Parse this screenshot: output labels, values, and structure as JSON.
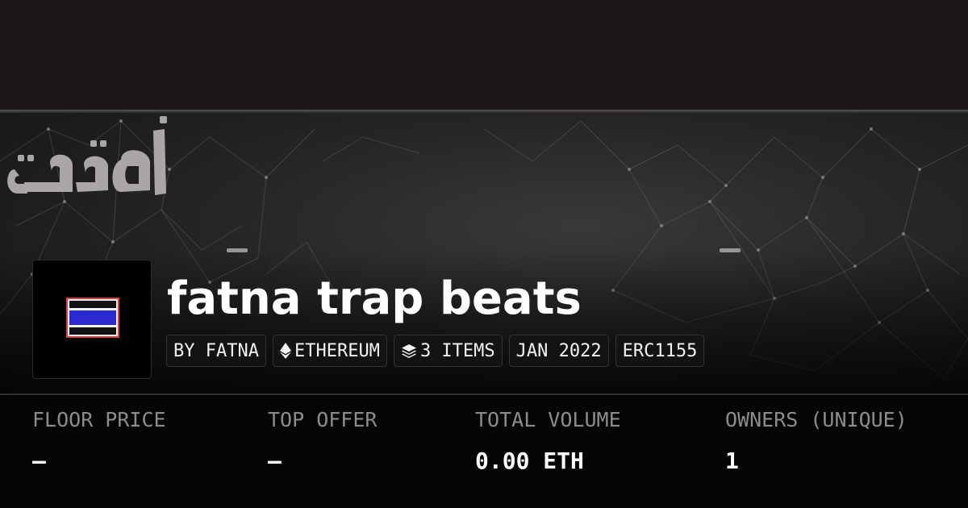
{
  "collection": {
    "title": "fatna trap beats",
    "tags": {
      "creator": "BY FATNA",
      "chain": "ETHEREUM",
      "chain_icon": "ethereum-icon",
      "items": "3 ITEMS",
      "items_icon": "layers-icon",
      "date": "JAN 2022",
      "standard": "ERC1155"
    }
  },
  "stats": {
    "floor_price": {
      "label": "FLOOR PRICE",
      "value": "—"
    },
    "top_offer": {
      "label": "TOP OFFER",
      "value": "—"
    },
    "total_volume": {
      "label": "TOTAL VOLUME",
      "value": "0.00 ETH"
    },
    "owners": {
      "label": "OWNERS (UNIQUE)",
      "value": "1"
    }
  },
  "avatar": {
    "image": "parental-advisory-logo"
  },
  "banner": {
    "image": "calligraphy-network-banner"
  },
  "colors": {
    "background": "#060606",
    "top_bar": "#1a1616",
    "label": "#8c8c8c",
    "text": "#ffffff",
    "tag_border": "#333333"
  }
}
